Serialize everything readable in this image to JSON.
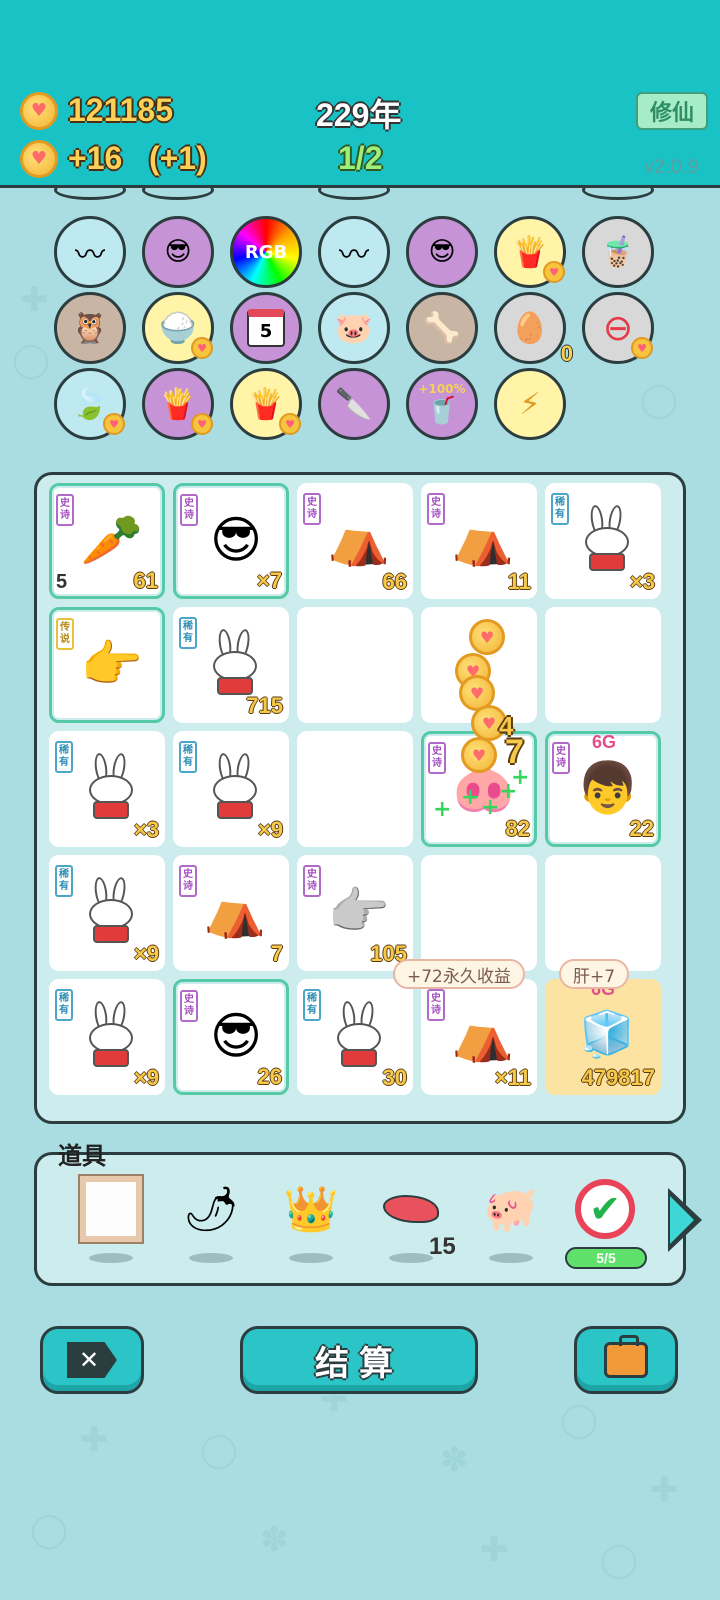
{
  "header": {
    "gold": "121185",
    "gold_rate": "+16",
    "gold_rate_bonus": "(+1)",
    "year": "229年",
    "progress": "1/2",
    "cultivate_label": "修仙",
    "version": "v2.0.9"
  },
  "buffs": {
    "egg_tray_count": "0",
    "increase_label": "+100%",
    "calendar_day": "5",
    "rgb_label": "RGB"
  },
  "tags": {
    "epic": "史诗",
    "rare": "稀有",
    "legend": "传说"
  },
  "board": {
    "cells": [
      {
        "value": "61",
        "left": "5"
      },
      {
        "value": "×7"
      },
      {
        "value": "66"
      },
      {
        "value": "11"
      },
      {
        "value": "×3"
      },
      {
        "value": ""
      },
      {
        "value": "715"
      },
      {
        "value": ""
      },
      {
        "value": ""
      },
      {
        "value": ""
      },
      {
        "value": "×3"
      },
      {
        "value": "×9"
      },
      {
        "value": ""
      },
      {
        "value": "82"
      },
      {
        "value": "22",
        "top": "6G"
      },
      {
        "value": "×9"
      },
      {
        "value": "7"
      },
      {
        "value": "105"
      },
      {
        "value": ""
      },
      {
        "value": ""
      },
      {
        "value": "×9"
      },
      {
        "value": "26"
      },
      {
        "value": "30"
      },
      {
        "value": "×11"
      },
      {
        "value": "479817",
        "top": "6G"
      }
    ],
    "float_numbers": [
      "4",
      "7"
    ],
    "bubble_income": "+72永久收益",
    "bubble_liver": "肝+7"
  },
  "props": {
    "title": "道具",
    "liver_count": "15",
    "check_badge": "5/5"
  },
  "buttons": {
    "settle": "结算"
  },
  "colors": {
    "header_bg": "#19c2c4",
    "page_bg": "#a9dde2",
    "button_bg": "#2bc5c8",
    "epic": "#a34fbf",
    "rare": "#2f8fb5",
    "legend": "#e5c23a"
  }
}
